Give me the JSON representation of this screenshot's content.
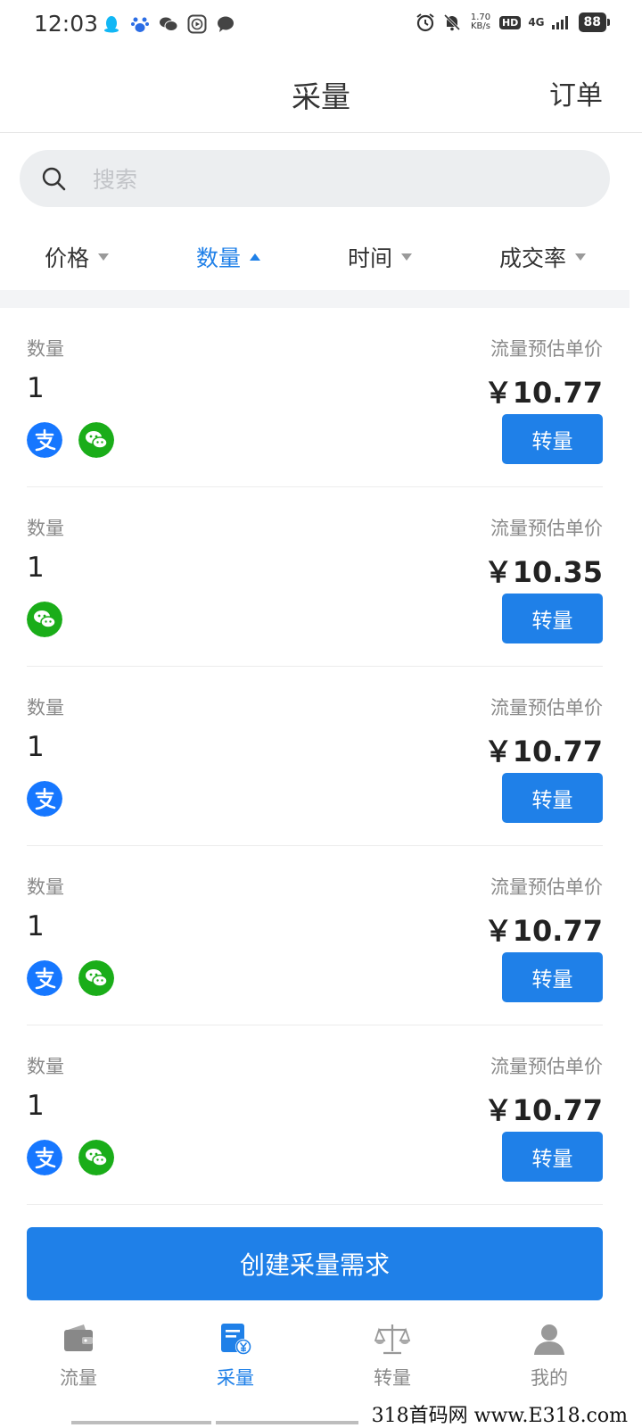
{
  "status_bar": {
    "time": "12:03",
    "net_speed_value": "1.70",
    "net_speed_unit": "KB/s",
    "hd": "HD",
    "network": "4G",
    "battery": "88"
  },
  "nav": {
    "title": "采量",
    "right_action": "订单"
  },
  "search": {
    "placeholder": "搜索"
  },
  "filters": [
    {
      "label": "价格",
      "sort": "down",
      "active": false
    },
    {
      "label": "数量",
      "sort": "up",
      "active": true
    },
    {
      "label": "时间",
      "sort": "down",
      "active": false
    },
    {
      "label": "成交率",
      "sort": "down",
      "active": false
    }
  ],
  "listing_label": "数量",
  "price_label": "流量预估单价",
  "transfer_label": "转量",
  "listings": [
    {
      "quantity": "1",
      "price": "￥10.77",
      "methods": [
        "alipay-icon",
        "wechat-icon"
      ]
    },
    {
      "quantity": "1",
      "price": "￥10.35",
      "methods": [
        "wechat-icon"
      ]
    },
    {
      "quantity": "1",
      "price": "￥10.77",
      "methods": [
        "alipay-icon"
      ]
    },
    {
      "quantity": "1",
      "price": "￥10.77",
      "methods": [
        "alipay-icon",
        "wechat-icon"
      ]
    },
    {
      "quantity": "1",
      "price": "￥10.77",
      "methods": [
        "alipay-icon",
        "wechat-icon"
      ]
    }
  ],
  "create_button": "创建采量需求",
  "tabs": [
    {
      "label": "流量",
      "icon": "wallet-icon",
      "active": false
    },
    {
      "label": "采量",
      "icon": "document-yen-icon",
      "active": true
    },
    {
      "label": "转量",
      "icon": "scale-icon",
      "active": false
    },
    {
      "label": "我的",
      "icon": "person-icon",
      "active": false
    }
  ],
  "watermark": "318首码网 www.E318.com",
  "colors": {
    "accent": "#1f80e8",
    "alipay": "#1677ff",
    "wechat": "#1aad19"
  }
}
